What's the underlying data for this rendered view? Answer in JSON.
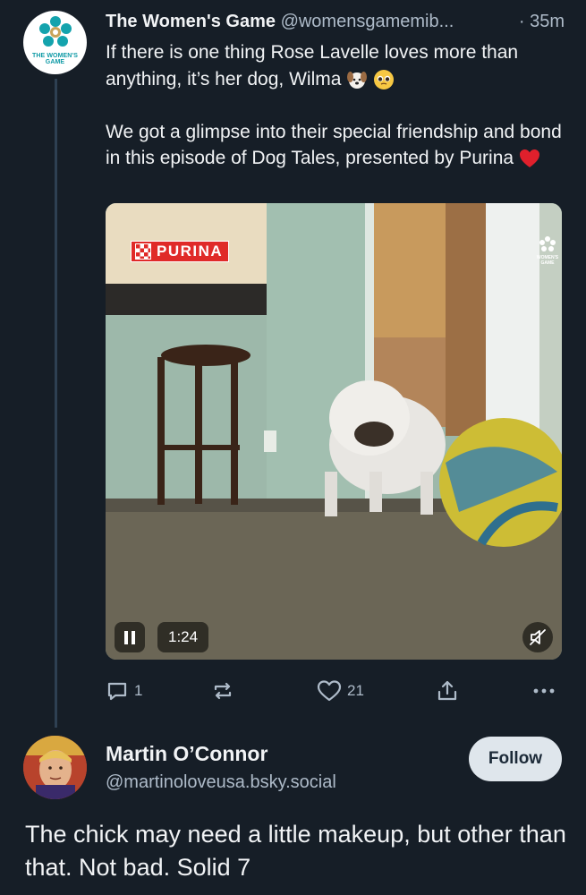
{
  "post": {
    "author_name": "The Women's Game",
    "author_handle": "@womensgamemib...",
    "time": "· 35m",
    "avatar_text": "THE WOMEN'S GAME",
    "paragraph1": "If there is one thing Rose Lavelle loves more than anything, it’s her dog, Wilma",
    "paragraph2": "We got a glimpse into their special friendship and bond in this episode of Dog Tales, presented by Purina",
    "video": {
      "brand_label": "PURINA",
      "watermark_text": "WOMEN'S GAME",
      "duration": "1:24",
      "play_state_icon": "pause-icon",
      "mute_icon": "muted-speaker-icon"
    },
    "actions": {
      "reply_count": "1",
      "repost_count": "",
      "like_count": "21",
      "icons": [
        "reply-icon",
        "repost-icon",
        "heart-icon",
        "share-icon",
        "more-icon"
      ]
    }
  },
  "reply": {
    "author_name": "Martin O’Connor",
    "author_handle": "@martinoloveusa.bsky.social",
    "follow_label": "Follow",
    "text": "The chick may need a little makeup, but other than that. Not bad. Solid 7"
  },
  "colors": {
    "background": "#161e27",
    "thread_line": "#2e4052",
    "muted_text": "#aebbc9",
    "follow_bg": "#dfe6ec",
    "brand_teal": "#0f9aa6"
  }
}
